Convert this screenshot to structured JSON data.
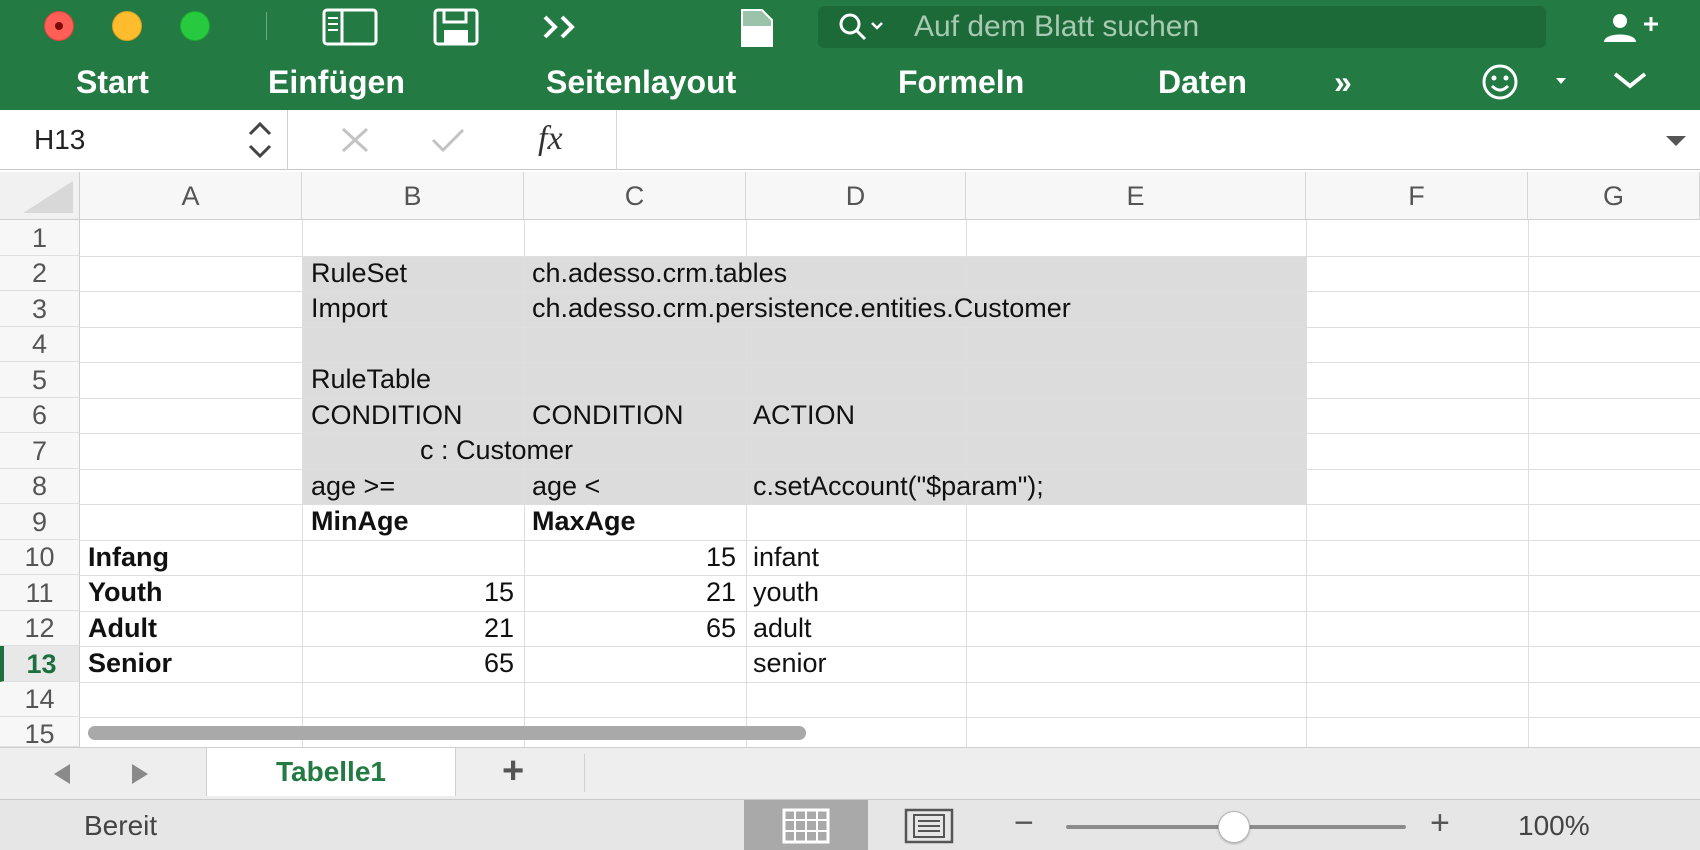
{
  "titlebar": {
    "search_placeholder": "Auf dem Blatt suchen"
  },
  "ribbon": {
    "tabs": [
      "Start",
      "Einfügen",
      "Seitenlayout",
      "Formeln",
      "Daten"
    ],
    "more": "»"
  },
  "formula_bar": {
    "name_box": "H13",
    "fx_symbol": "fx",
    "formula": ""
  },
  "sheet": {
    "columns": [
      "A",
      "B",
      "C",
      "D",
      "E",
      "F",
      "G"
    ],
    "rows": [
      "1",
      "2",
      "3",
      "4",
      "5",
      "6",
      "7",
      "8",
      "9",
      "10",
      "11",
      "12",
      "13",
      "14",
      "15"
    ],
    "active_row": "13",
    "cells": {
      "B2": "RuleSet",
      "C2": "ch.adesso.crm.tables",
      "B3": "Import",
      "C3": "ch.adesso.crm.persistence.entities.Customer",
      "B5": "RuleTable",
      "B6": "CONDITION",
      "C6": "CONDITION",
      "D6": "ACTION",
      "B7": "c : Customer",
      "B8": "age >=",
      "C8": "age <",
      "D8": "c.setAccount(\"$param\");",
      "B9": "MinAge",
      "C9": "MaxAge",
      "A10": "Infang",
      "C10": "15",
      "D10": "infant",
      "A11": "Youth",
      "B11": "15",
      "C11": "21",
      "D11": "youth",
      "A12": "Adult",
      "B12": "21",
      "C12": "65",
      "D12": "adult",
      "A13": "Senior",
      "B13": "65",
      "D13": "senior"
    }
  },
  "sheet_tabs": {
    "active": "Tabelle1",
    "add": "+"
  },
  "status": {
    "text": "Bereit",
    "zoom": "100%",
    "zoom_minus": "−",
    "zoom_plus": "+"
  },
  "colors": {
    "ribbon_green": "#237a43",
    "rule_band_gray": "#dcdcdc",
    "active_sheet_text": "#237a43"
  }
}
